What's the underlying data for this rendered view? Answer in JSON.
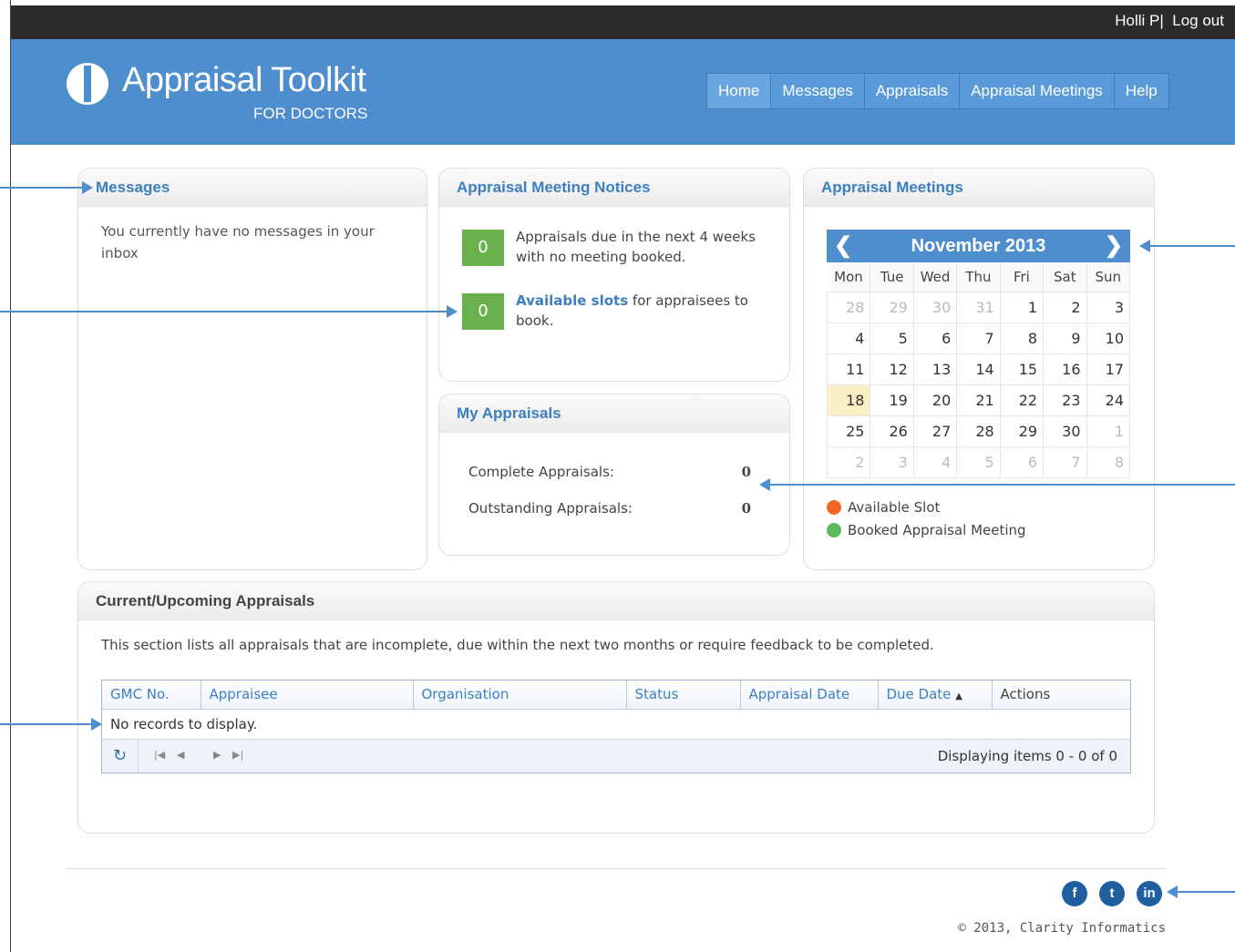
{
  "topbar": {
    "user": "Holli P",
    "separator": "|",
    "logout": "Log out"
  },
  "header": {
    "app_name": "Appraisal Toolkit",
    "app_subtitle": "FOR DOCTORS"
  },
  "nav": {
    "items": [
      "Home",
      "Messages",
      "Appraisals",
      "Appraisal Meetings",
      "Help"
    ],
    "active": "Home"
  },
  "messages": {
    "title": "Messages",
    "body": "You currently have no messages in your inbox"
  },
  "notices": {
    "title": "Appraisal Meeting Notices",
    "due_count": "0",
    "due_text": "Appraisals due in the next 4 weeks with no meeting booked.",
    "slots_count": "0",
    "slots_link": "Available slots",
    "slots_text": " for appraisees to book."
  },
  "my_appraisals": {
    "title": "My Appraisals",
    "complete_label": "Complete Appraisals:",
    "complete_value": "0",
    "outstanding_label": "Outstanding Appraisals:",
    "outstanding_value": "0"
  },
  "meetings": {
    "title": "Appraisal Meetings",
    "month": "November 2013",
    "weekdays": [
      "Mon",
      "Tue",
      "Wed",
      "Thu",
      "Fri",
      "Sat",
      "Sun"
    ],
    "weeks": [
      [
        [
          "28",
          1
        ],
        [
          "29",
          1
        ],
        [
          "30",
          1
        ],
        [
          "31",
          1
        ],
        [
          "1",
          0
        ],
        [
          "2",
          0
        ],
        [
          "3",
          0
        ]
      ],
      [
        [
          "4",
          0
        ],
        [
          "5",
          0
        ],
        [
          "6",
          0
        ],
        [
          "7",
          0
        ],
        [
          "8",
          0
        ],
        [
          "9",
          0
        ],
        [
          "10",
          0
        ]
      ],
      [
        [
          "11",
          0
        ],
        [
          "12",
          0
        ],
        [
          "13",
          0
        ],
        [
          "14",
          0
        ],
        [
          "15",
          0
        ],
        [
          "16",
          0
        ],
        [
          "17",
          0
        ]
      ],
      [
        [
          "18",
          0
        ],
        [
          "19",
          0
        ],
        [
          "20",
          0
        ],
        [
          "21",
          0
        ],
        [
          "22",
          0
        ],
        [
          "23",
          0
        ],
        [
          "24",
          0
        ]
      ],
      [
        [
          "25",
          0
        ],
        [
          "26",
          0
        ],
        [
          "27",
          0
        ],
        [
          "28",
          0
        ],
        [
          "29",
          0
        ],
        [
          "30",
          0
        ],
        [
          "1",
          1
        ]
      ],
      [
        [
          "2",
          1
        ],
        [
          "3",
          1
        ],
        [
          "4",
          1
        ],
        [
          "5",
          1
        ],
        [
          "6",
          1
        ],
        [
          "7",
          1
        ],
        [
          "8",
          1
        ]
      ]
    ],
    "today": "18",
    "legend_available": "Available Slot",
    "legend_booked": "Booked Appraisal Meeting",
    "color_available": "#f26522",
    "color_booked": "#5cb85c"
  },
  "upcoming": {
    "title": "Current/Upcoming Appraisals",
    "description": "This section lists all appraisals that are incomplete, due within the next two months or require feedback to be completed.",
    "columns": [
      "GMC No.",
      "Appraisee",
      "Organisation",
      "Status",
      "Appraisal Date",
      "Due Date",
      "Actions"
    ],
    "sort_indicator": "▲",
    "empty_text": "No records to display.",
    "pager_info": "Displaying items 0 - 0 of 0"
  },
  "footer": {
    "social": [
      "facebook-icon",
      "twitter-icon",
      "linkedin-icon"
    ],
    "copyright": "© 2013, Clarity Informatics"
  },
  "colors": {
    "header": "#4e8ecf",
    "topbar": "#2b2b2b",
    "count_box": "#6ab04c",
    "link": "#3c7fc0"
  }
}
